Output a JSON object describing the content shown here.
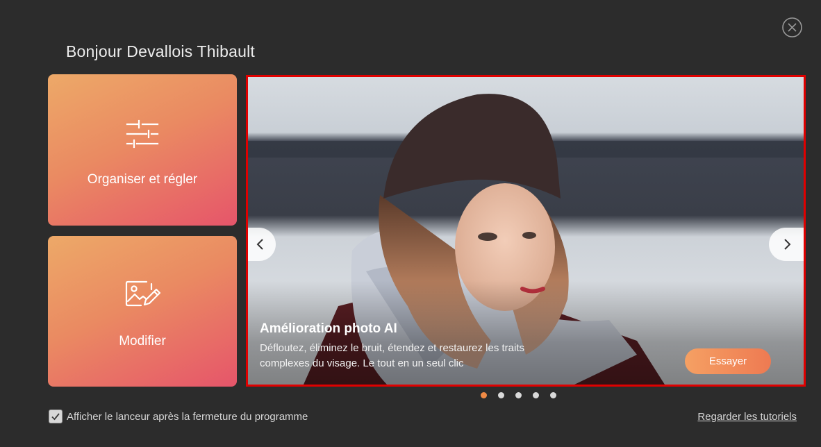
{
  "greeting": "Bonjour Devallois Thibault",
  "cards": [
    {
      "label": "Organiser et régler",
      "icon": "sliders-icon"
    },
    {
      "label": "Modifier",
      "icon": "image-edit-icon"
    }
  ],
  "banner": {
    "title": "Amélioration photo AI",
    "description_line1": "Défloutez, éliminez le bruit, étendez et restaurez les traits",
    "description_line2": "complexes du visage. Le tout en un seul clic",
    "cta_label": "Essayer",
    "slide_count": 5,
    "active_slide": 1
  },
  "footer": {
    "checkbox_label": "Afficher le lanceur après la fermeture du programme",
    "checkbox_checked": true,
    "tutorial_link": "Regarder les tutoriels"
  },
  "colors": {
    "background": "#2c2c2c",
    "card_gradient_start": "#eda968",
    "card_gradient_end": "#e6556a",
    "accent": "#f08a45",
    "highlight_border": "#e00000"
  }
}
